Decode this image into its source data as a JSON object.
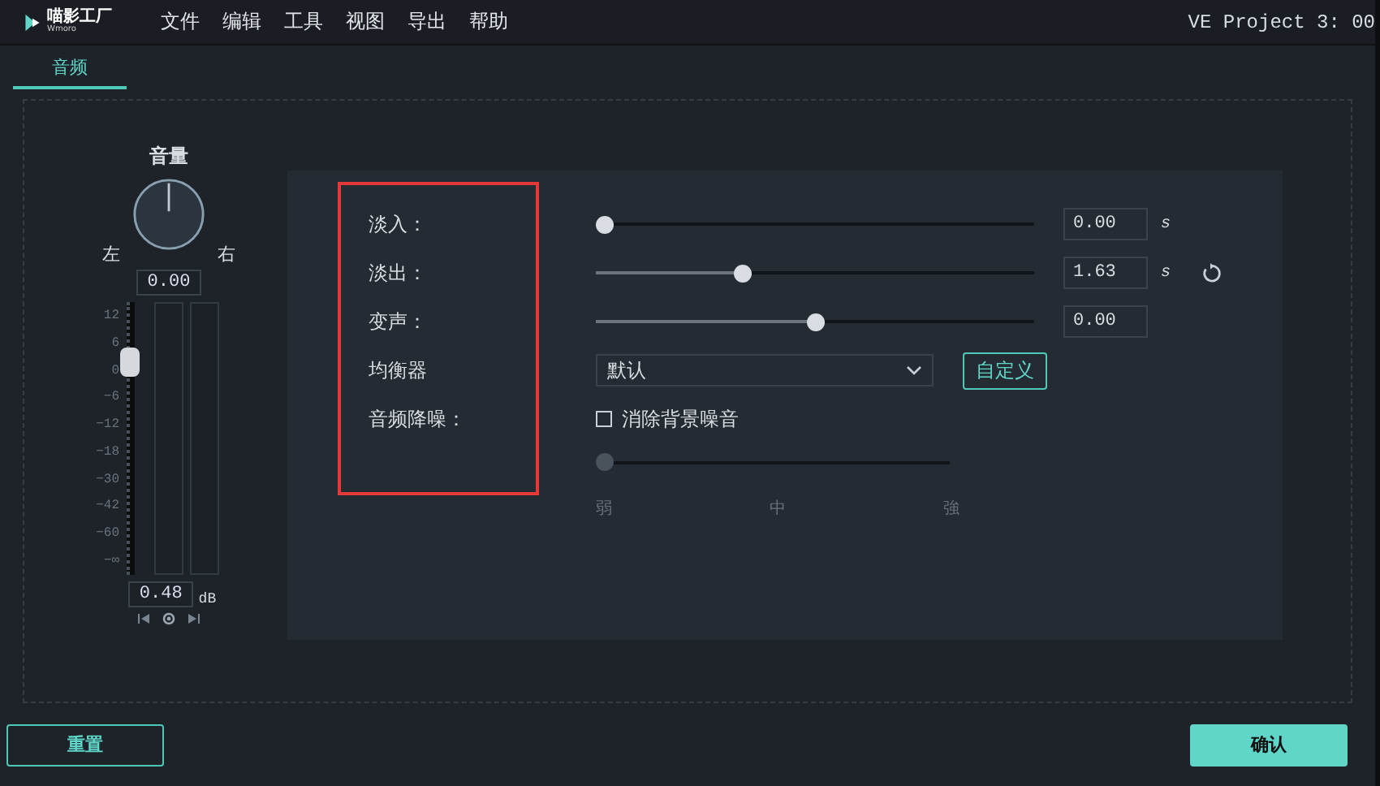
{
  "app": {
    "logo_text": "喵影工厂",
    "logo_subtext": "Wmoro"
  },
  "menu": [
    "文件",
    "编辑",
    "工具",
    "视图",
    "导出",
    "帮助"
  ],
  "window": {
    "title": "VE Project 3: 00"
  },
  "tabs": [
    {
      "label": "音频",
      "selected": true
    }
  ],
  "volume": {
    "title": "音量",
    "pan_left": "左",
    "pan_right": "右",
    "pan_value": "0.00",
    "scale": [
      "12",
      "6",
      "0",
      "−6",
      "−12",
      "−18",
      "−30",
      "−42",
      "−60",
      "−∞"
    ],
    "fader": {
      "level": 0.78
    },
    "gain_value": "0.48",
    "gain_unit": "dB"
  },
  "settings": [
    {
      "kind": "slider",
      "label": "淡入：",
      "level": 0,
      "value": "0.00",
      "unit": "s"
    },
    {
      "kind": "slider",
      "label": "淡出：",
      "level": 0.33,
      "value": "1.63",
      "unit": "s",
      "reset": true
    },
    {
      "kind": "slider",
      "label": "变声：",
      "level": 0.5,
      "value": "0.00"
    },
    {
      "kind": "dropdown",
      "label": "均衡器",
      "value": "默认",
      "button": "自定义"
    },
    {
      "kind": "checkbox",
      "label": "音频降噪：",
      "text": "消除背景噪音",
      "checked": false
    }
  ],
  "denoise": {
    "level": 0,
    "disabled": true,
    "marks": [
      "弱",
      "中",
      "強"
    ]
  },
  "buttons": [
    {
      "label": "重置",
      "primary": false
    },
    {
      "label": "确认",
      "primary": true
    }
  ]
}
